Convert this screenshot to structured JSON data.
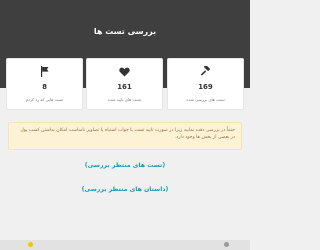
{
  "header": {
    "title": "بررسی تست ها"
  },
  "stats": [
    {
      "icon": "flag-icon",
      "value": "8",
      "label": "تست هایی که رد کردم"
    },
    {
      "icon": "heart-icon",
      "value": "161",
      "label": "تست های تایید شده"
    },
    {
      "icon": "gavel-icon",
      "value": "169",
      "label": "تست های بررسی شده"
    }
  ],
  "notice": {
    "text": "حتماً در بررسی دقت نمایید زیرا در صورت تایید تست با جواب اشتباه یا تصاویر نامناسب امکان نداشتن کسب پول در بعضی از بخش ها وجود دارد."
  },
  "links": {
    "pending_tests": "(تست های منتظر بررسی)",
    "pending_stories": "(داستان های منتظر بررسی)"
  },
  "colors": {
    "header_bg": "#3f3f3f",
    "link": "#1a9bb0",
    "notice_bg": "#fdf2d6",
    "notice_text": "#8a6d3b"
  }
}
